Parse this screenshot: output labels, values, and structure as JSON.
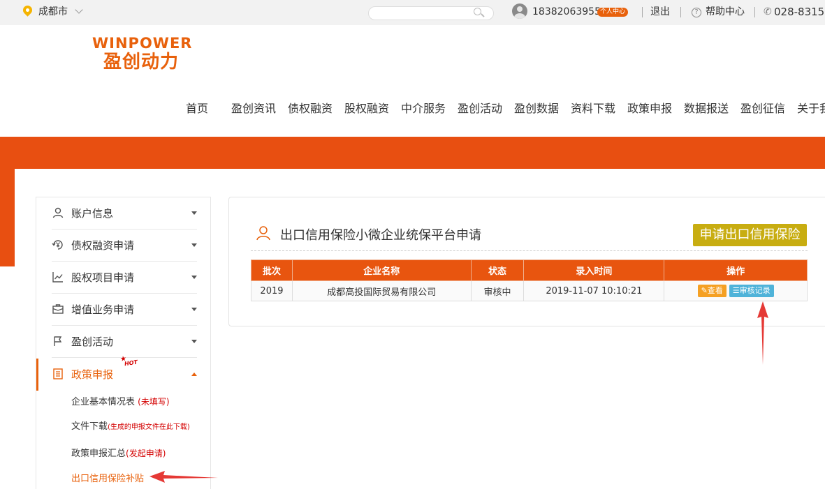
{
  "topbar": {
    "city": "成都市",
    "search_placeholder": "",
    "phone_user": "18382063955",
    "user_center_badge": "个人中心",
    "logout": "退出",
    "help": "帮助中心",
    "hotline": "028-8315-"
  },
  "logo": {
    "en": "WINPOWER",
    "cn": "盈创动力"
  },
  "nav": [
    "首页",
    "盈创资讯",
    "债权融资",
    "股权融资",
    "中介服务",
    "盈创活动",
    "盈创数据",
    "资料下载",
    "政策申报",
    "数据报送",
    "盈创征信",
    "关于我"
  ],
  "sidebar": {
    "items": [
      {
        "label": "账户信息",
        "icon": "user-icon"
      },
      {
        "label": "债权融资申请",
        "icon": "yen-cycle-icon"
      },
      {
        "label": "股权项目申请",
        "icon": "line-chart-icon"
      },
      {
        "label": "增值业务申请",
        "icon": "briefcase-icon"
      },
      {
        "label": "盈创活动",
        "icon": "flag-icon"
      },
      {
        "label": "政策申报",
        "icon": "document-icon"
      }
    ],
    "hot_badge": "HOT",
    "subitems": [
      {
        "label": "企业基本情况表",
        "note": "(未填写)"
      },
      {
        "label": "文件下载",
        "note": "(生成的申报文件在此下载)"
      },
      {
        "label": "政策申报汇总",
        "note": "(发起申请)"
      },
      {
        "label": "出口信用保险补贴",
        "note": ""
      }
    ]
  },
  "panel": {
    "title": "出口信用保险小微企业统保平台申请",
    "apply_button": "申请出口信用保险",
    "columns": [
      "批次",
      "企业名称",
      "状态",
      "录入时间",
      "操作"
    ],
    "rows": [
      {
        "batch": "2019",
        "company": "成都高投国际贸易有限公司",
        "status": "审核中",
        "time": "2019-11-07 10:10:21",
        "view": "查看",
        "log": "审核记录"
      }
    ]
  },
  "colors": {
    "brand": "#e8610c",
    "band": "#e84f11",
    "apply": "#c8ad11",
    "view": "#f5a023",
    "log": "#4fb3d9",
    "arrow": "#e53935"
  }
}
